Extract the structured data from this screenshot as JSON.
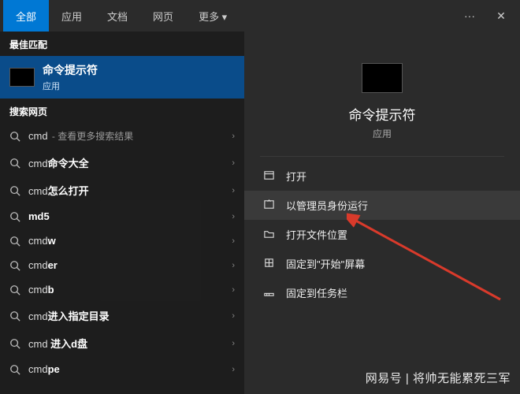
{
  "tabs": {
    "items": [
      "全部",
      "应用",
      "文档",
      "网页",
      "更多"
    ],
    "more_glyph": "▾",
    "active_index": 0
  },
  "left": {
    "best_match_header": "最佳匹配",
    "best_match": {
      "title": "命令提示符",
      "subtitle": "应用"
    },
    "web_header": "搜索网页",
    "items": [
      {
        "prefix": "cmd",
        "suffix": "",
        "hint": " - 查看更多搜索结果"
      },
      {
        "prefix": "cmd",
        "suffix": "命令大全",
        "hint": ""
      },
      {
        "prefix": "cmd",
        "suffix": "怎么打开",
        "hint": ""
      },
      {
        "prefix": "md5",
        "suffix": "",
        "hint": "",
        "all_bold": true
      },
      {
        "prefix": "cmd",
        "suffix": "w",
        "hint": ""
      },
      {
        "prefix": "cmd",
        "suffix": "er",
        "hint": ""
      },
      {
        "prefix": "cmd",
        "suffix": "b",
        "hint": ""
      },
      {
        "prefix": "cmd",
        "suffix": "进入指定目录",
        "hint": ""
      },
      {
        "prefix": "cmd ",
        "suffix": "进入d盘",
        "hint": ""
      },
      {
        "prefix": "cmd",
        "suffix": "pe",
        "hint": ""
      }
    ]
  },
  "right": {
    "title": "命令提示符",
    "subtitle": "应用",
    "actions": [
      {
        "id": "open",
        "label": "打开"
      },
      {
        "id": "run-admin",
        "label": "以管理员身份运行",
        "highlight": true
      },
      {
        "id": "open-location",
        "label": "打开文件位置"
      },
      {
        "id": "pin-start",
        "label": "固定到\"开始\"屏幕"
      },
      {
        "id": "pin-taskbar",
        "label": "固定到任务栏"
      }
    ]
  },
  "watermark": "网易号 | 将帅无能累死三军",
  "icons": {
    "ellipsis": "···",
    "close": "✕",
    "chevron": "›"
  }
}
